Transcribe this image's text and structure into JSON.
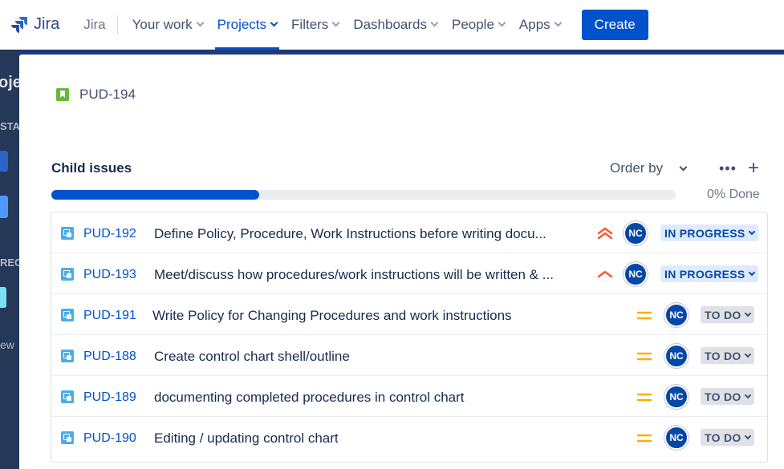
{
  "topnav": {
    "logo_text": "Jira",
    "product": "Jira",
    "items": [
      {
        "label": "Your work"
      },
      {
        "label": "Projects"
      },
      {
        "label": "Filters"
      },
      {
        "label": "Dashboards"
      },
      {
        "label": "People"
      },
      {
        "label": "Apps"
      }
    ],
    "active_index": 1,
    "create_label": "Create"
  },
  "background_sidebar": {
    "fragment_1": "oje",
    "fragment_2": "STA",
    "fragment_3": "REC",
    "fragment_4": "ew"
  },
  "issue": {
    "key": "PUD-194",
    "type_icon": "story-icon"
  },
  "child_issues": {
    "title": "Child issues",
    "order_by_label": "Order by",
    "more_icon": "more-icon",
    "add_icon": "plus-icon",
    "progress_percent_fill": 0.333,
    "done_text": "0% Done",
    "rows": [
      {
        "key": "PUD-192",
        "summary": "Define Policy, Procedure, Work Instructions before writing docu...",
        "priority": "highest",
        "assignee": "NC",
        "status": "IN PROGRESS"
      },
      {
        "key": "PUD-193",
        "summary": "Meet/discuss how procedures/work instructions will be written & ...",
        "priority": "high",
        "assignee": "NC",
        "status": "IN PROGRESS"
      },
      {
        "key": "PUD-191",
        "summary": "Write Policy for Changing Procedures and work instructions",
        "priority": "medium",
        "assignee": "NC",
        "status": "TO DO"
      },
      {
        "key": "PUD-188",
        "summary": "Create control chart shell/outline",
        "priority": "medium",
        "assignee": "NC",
        "status": "TO DO"
      },
      {
        "key": "PUD-189",
        "summary": "documenting completed procedures in control chart",
        "priority": "medium",
        "assignee": "NC",
        "status": "TO DO"
      },
      {
        "key": "PUD-190",
        "summary": "Editing / updating control chart",
        "priority": "medium",
        "assignee": "NC",
        "status": "TO DO"
      }
    ]
  },
  "colors": {
    "brand": "#0052cc",
    "priority_high": "#ff5630",
    "priority_medium": "#ffab00",
    "in_progress_bg": "#deebff",
    "todo_bg": "#dfe1e6"
  }
}
